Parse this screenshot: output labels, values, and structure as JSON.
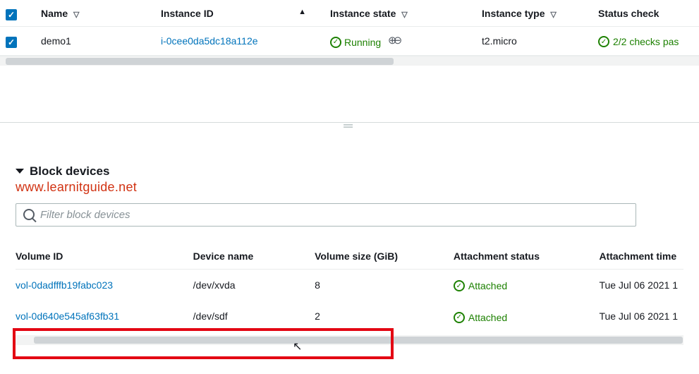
{
  "instances": {
    "headers": {
      "name": "Name",
      "instance_id": "Instance ID",
      "state": "Instance state",
      "type": "Instance type",
      "status_check": "Status check"
    },
    "rows": [
      {
        "name": "demo1",
        "instance_id": "i-0cee0da5dc18a112e",
        "state": "Running",
        "type": "t2.micro",
        "status_check": "2/2 checks pas"
      }
    ]
  },
  "panel": {
    "section_title": "Block devices",
    "watermark": "www.learnitguide.net",
    "filter_placeholder": "Filter block devices"
  },
  "block_devices": {
    "headers": {
      "volume_id": "Volume ID",
      "device_name": "Device name",
      "volume_size": "Volume size (GiB)",
      "attachment_status": "Attachment status",
      "attachment_time": "Attachment time"
    },
    "rows": [
      {
        "volume_id": "vol-0dadfffb19fabc023",
        "device_name": "/dev/xvda",
        "volume_size": "8",
        "attachment_status": "Attached",
        "attachment_time": "Tue Jul 06 2021 1"
      },
      {
        "volume_id": "vol-0d640e545af63fb31",
        "device_name": "/dev/sdf",
        "volume_size": "2",
        "attachment_status": "Attached",
        "attachment_time": "Tue Jul 06 2021 1"
      }
    ]
  }
}
